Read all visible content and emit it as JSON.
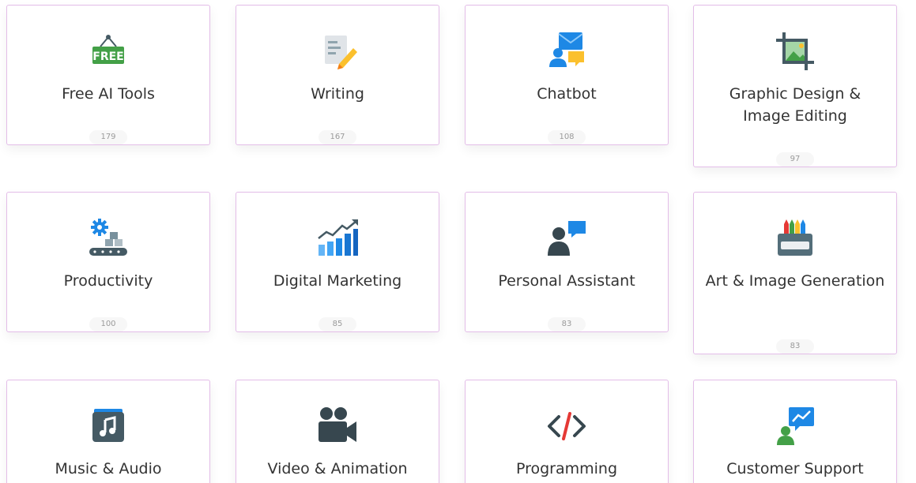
{
  "categories": [
    {
      "label": "Free AI Tools",
      "count": "179",
      "icon": "free-sign-icon"
    },
    {
      "label": "Writing",
      "count": "167",
      "icon": "document-pencil-icon"
    },
    {
      "label": "Chatbot",
      "count": "108",
      "icon": "chat-user-icon"
    },
    {
      "label": "Graphic Design & Image Editing",
      "count": "97",
      "icon": "crop-image-icon"
    },
    {
      "label": "Productivity",
      "count": "100",
      "icon": "gear-conveyor-icon"
    },
    {
      "label": "Digital Marketing",
      "count": "85",
      "icon": "growth-chart-icon"
    },
    {
      "label": "Personal Assistant",
      "count": "83",
      "icon": "user-message-icon"
    },
    {
      "label": "Art & Image Generation",
      "count": "83",
      "icon": "crayons-icon"
    },
    {
      "label": "Music & Audio",
      "count": "",
      "icon": "music-note-icon"
    },
    {
      "label": "Video & Animation",
      "count": "",
      "icon": "video-camera-icon"
    },
    {
      "label": "Programming",
      "count": "",
      "icon": "code-icon"
    },
    {
      "label": "Customer Support",
      "count": "",
      "icon": "support-chart-icon"
    }
  ],
  "colors": {
    "card_border": "#e3bde8",
    "text": "#333333",
    "count_text": "#9a9a9a",
    "green": "#43a047",
    "blue": "#1e88e5",
    "yellow": "#fbc02d",
    "slate": "#455a64"
  }
}
